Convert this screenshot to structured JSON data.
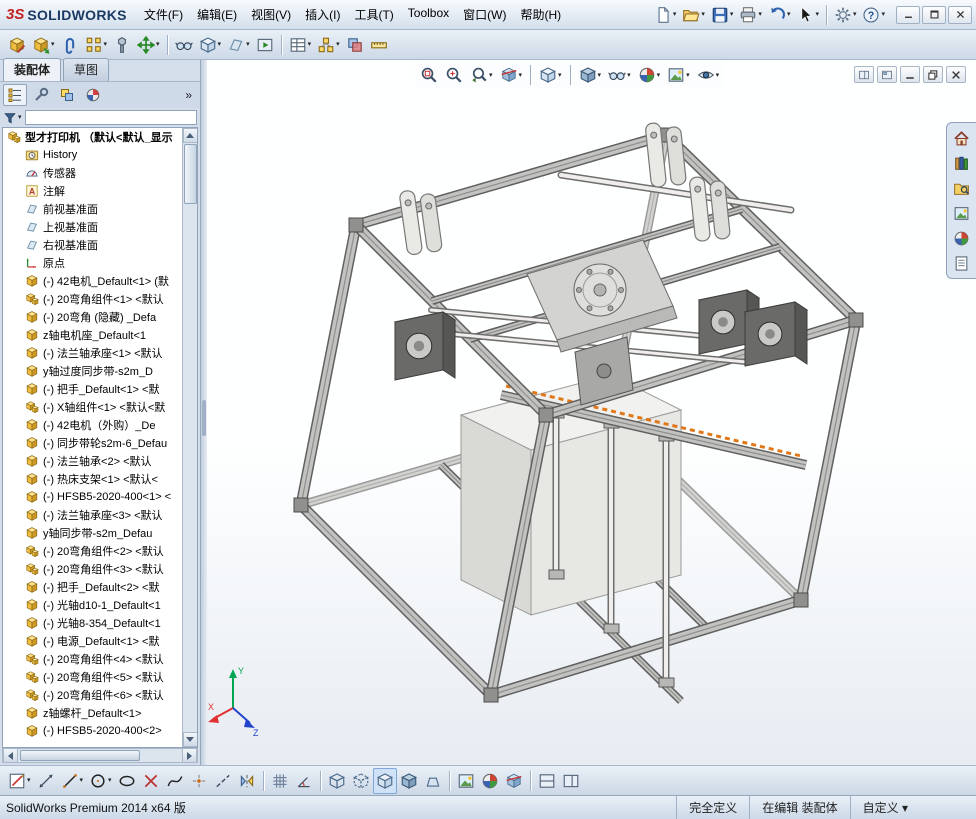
{
  "titlebar": {
    "logo_prefix": "3S",
    "logo_text": "SOLIDWORKS",
    "menus": [
      "文件(F)",
      "编辑(E)",
      "视图(V)",
      "插入(I)",
      "工具(T)",
      "Toolbox",
      "窗口(W)",
      "帮助(H)"
    ],
    "window_buttons": [
      "minimize",
      "maximize",
      "close"
    ]
  },
  "ui": {
    "caret_glyph": "▾",
    "overflow_glyph": "»"
  },
  "quick_toolbar": [
    {
      "name": "new-document",
      "caret": true
    },
    {
      "name": "open",
      "caret": true
    },
    {
      "name": "save",
      "caret": true
    },
    {
      "name": "print",
      "caret": true
    },
    {
      "name": "undo",
      "caret": true
    },
    {
      "name": "select-cursor",
      "caret": true
    },
    {
      "sep": true
    },
    {
      "name": "options-gear",
      "caret": true
    },
    {
      "name": "help",
      "caret": true
    }
  ],
  "assembly_toolbar": [
    {
      "name": "edit-component"
    },
    {
      "name": "insert-component",
      "caret": true
    },
    {
      "name": "mate"
    },
    {
      "name": "component-pattern",
      "caret": true
    },
    {
      "name": "smart-fasteners"
    },
    {
      "name": "move-component",
      "caret": true
    },
    {
      "sep": true
    },
    {
      "name": "show-hidden-components"
    },
    {
      "name": "assembly-features",
      "caret": true
    },
    {
      "name": "reference-geometry",
      "caret": true
    },
    {
      "name": "new-motion-study"
    },
    {
      "sep": true
    },
    {
      "name": "bill-of-materials",
      "caret": true
    },
    {
      "name": "exploded-view",
      "caret": true
    },
    {
      "name": "interference-detection"
    },
    {
      "name": "measure"
    }
  ],
  "feature_panel": {
    "doc_tabs": [
      {
        "label": "装配体",
        "active": true
      },
      {
        "label": "草图",
        "active": false
      }
    ],
    "pane_tabs": [
      {
        "name": "featuremanager",
        "icon": "fm-tree",
        "pressed": true
      },
      {
        "name": "propertymanager",
        "icon": "property-mgr",
        "pressed": false
      },
      {
        "name": "configurationmanager",
        "icon": "config-mgr",
        "pressed": false
      },
      {
        "name": "displaymanager",
        "icon": "display-mgr",
        "pressed": false
      }
    ],
    "filter": {
      "value": "",
      "placeholder": ""
    },
    "root": {
      "icon": "assembly",
      "label": "型才打印机 （默认<默认_显示"
    },
    "items": [
      {
        "icon": "history",
        "label": "History"
      },
      {
        "icon": "sensor",
        "label": "传感器"
      },
      {
        "icon": "annotation",
        "label": "注解"
      },
      {
        "icon": "plane",
        "label": "前视基准面"
      },
      {
        "icon": "plane",
        "label": "上视基准面"
      },
      {
        "icon": "plane",
        "label": "右视基准面"
      },
      {
        "icon": "origin-tree",
        "label": "原点"
      },
      {
        "icon": "part",
        "label": "(-) 42电机_Default<1> (默"
      },
      {
        "icon": "assembly",
        "label": "(-) 20弯角组件<1> <默认"
      },
      {
        "icon": "part",
        "label": "(-) 20弯角 (隐藏) _Defa"
      },
      {
        "icon": "part",
        "label": "z轴电机座_Default<1"
      },
      {
        "icon": "part",
        "label": "(-) 法兰轴承座<1> <默认"
      },
      {
        "icon": "part",
        "label": "y轴过度同步带-s2m_D"
      },
      {
        "icon": "part",
        "label": "(-) 把手_Default<1> <默"
      },
      {
        "icon": "assembly",
        "label": "(-) X轴组件<1> <默认<默"
      },
      {
        "icon": "part",
        "label": "(-) 42电机（外购）_De"
      },
      {
        "icon": "part",
        "label": "(-) 同步带轮s2m-6_Defau"
      },
      {
        "icon": "part",
        "label": "(-) 法兰轴承<2> <默认"
      },
      {
        "icon": "part",
        "label": "(-) 热床支架<1> <默认<"
      },
      {
        "icon": "part",
        "label": "(-) HFSB5-2020-400<1> <"
      },
      {
        "icon": "part",
        "label": "(-) 法兰轴承座<3> <默认"
      },
      {
        "icon": "part",
        "label": "y轴同步带-s2m_Defau"
      },
      {
        "icon": "assembly",
        "label": "(-) 20弯角组件<2> <默认"
      },
      {
        "icon": "assembly",
        "label": "(-) 20弯角组件<3> <默认"
      },
      {
        "icon": "part",
        "label": "(-) 把手_Default<2> <默"
      },
      {
        "icon": "part",
        "label": "(-) 光轴d10-1_Default<1"
      },
      {
        "icon": "part",
        "label": "(-) 光轴8-354_Default<1"
      },
      {
        "icon": "part",
        "label": "(-) 电源_Default<1> <默"
      },
      {
        "icon": "assembly",
        "label": "(-) 20弯角组件<4> <默认"
      },
      {
        "icon": "assembly",
        "label": "(-) 20弯角组件<5> <默认"
      },
      {
        "icon": "assembly",
        "label": "(-) 20弯角组件<6> <默认"
      },
      {
        "icon": "part",
        "label": "z轴螺杆_Default<1>"
      },
      {
        "icon": "part",
        "label": "(-) HFSB5-2020-400<2>"
      }
    ]
  },
  "viewport": {
    "heads_up": [
      {
        "name": "zoom-fit"
      },
      {
        "name": "zoom-area"
      },
      {
        "name": "previous-view",
        "caret": true
      },
      {
        "name": "section-view",
        "caret": true
      },
      {
        "sep": true
      },
      {
        "name": "view-orientation",
        "caret": true
      },
      {
        "sep": true
      },
      {
        "name": "display-style",
        "caret": true
      },
      {
        "name": "hide-show-items",
        "caret": true
      },
      {
        "name": "edit-appearance",
        "caret": true
      },
      {
        "name": "apply-scene",
        "caret": true
      },
      {
        "name": "view-settings",
        "caret": true
      }
    ],
    "doc_controls": [
      "display-pane",
      "preview-pane",
      "minimize",
      "restore",
      "close"
    ],
    "task_pane": [
      "home",
      "design-library",
      "file-explorer",
      "view-palette",
      "appearances",
      "custom-properties"
    ],
    "triad": {
      "x": "X",
      "y": "Y",
      "z": "Z"
    }
  },
  "sketch_toolbar": [
    {
      "name": "sketch",
      "caret": true
    },
    {
      "name": "smart-dimension"
    },
    {
      "name": "line",
      "caret": true
    },
    {
      "name": "circle",
      "caret": true
    },
    {
      "name": "ellipse"
    },
    {
      "name": "trim-entities"
    },
    {
      "name": "spline"
    },
    {
      "name": "point"
    },
    {
      "name": "centerline"
    },
    {
      "name": "mirror-entities"
    },
    {
      "sep": true
    },
    {
      "name": "grid"
    },
    {
      "name": "angle-snap"
    },
    {
      "sep": true
    },
    {
      "name": "wireframe-view"
    },
    {
      "name": "hidden-lines-view"
    },
    {
      "name": "shaded-edges-view",
      "pressed": true
    },
    {
      "name": "shaded-view"
    },
    {
      "name": "perspective-view"
    },
    {
      "sep": true
    },
    {
      "name": "apply-scene"
    },
    {
      "name": "edit-appearance"
    },
    {
      "name": "section-view"
    },
    {
      "sep": true
    },
    {
      "name": "split-pane-h"
    },
    {
      "name": "display-pane"
    }
  ],
  "status_bar": {
    "left": "SolidWorks Premium 2014 x64 版",
    "cells": [
      {
        "label": "完全定义",
        "caret": false,
        "interactable": false
      },
      {
        "label": "在编辑 装配体",
        "caret": false,
        "interactable": false
      },
      {
        "label": "自定义",
        "caret": true,
        "interactable": true
      }
    ]
  }
}
